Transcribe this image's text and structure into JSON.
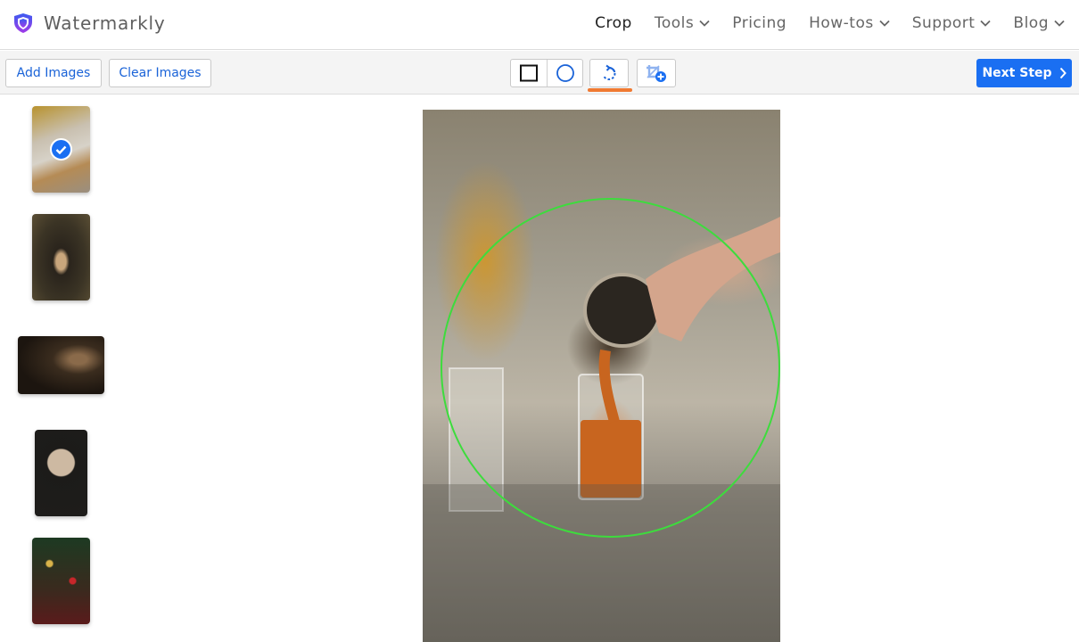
{
  "header": {
    "brand": "Watermarkly",
    "nav": [
      {
        "label": "Crop",
        "active": true,
        "dropdown": false
      },
      {
        "label": "Tools",
        "active": false,
        "dropdown": true
      },
      {
        "label": "Pricing",
        "active": false,
        "dropdown": false
      },
      {
        "label": "How-tos",
        "active": false,
        "dropdown": true
      },
      {
        "label": "Support",
        "active": false,
        "dropdown": true
      },
      {
        "label": "Blog",
        "active": false,
        "dropdown": true
      }
    ]
  },
  "toolbar": {
    "add_images": "Add Images",
    "clear_images": "Clear Images",
    "tools": [
      "rectangle-crop",
      "circle-crop",
      "rotate",
      "add-crop-area"
    ],
    "active_tool": "rotate",
    "next_step": "Next Step"
  },
  "colors": {
    "brand_blue": "#1a6ff2",
    "active_underline": "#f07a32",
    "crop_outline": "#3ddc3d"
  },
  "thumbnails": [
    {
      "subject": "pouring drink into glass",
      "selected": true
    },
    {
      "subject": "woman seated in armchair",
      "selected": false
    },
    {
      "subject": "man working at desk",
      "selected": false
    },
    {
      "subject": "view through arched window",
      "selected": false
    },
    {
      "subject": "christmas tree with candles",
      "selected": false
    }
  ],
  "editor": {
    "image": "pouring drink into glass",
    "crop_shape": "circle"
  }
}
